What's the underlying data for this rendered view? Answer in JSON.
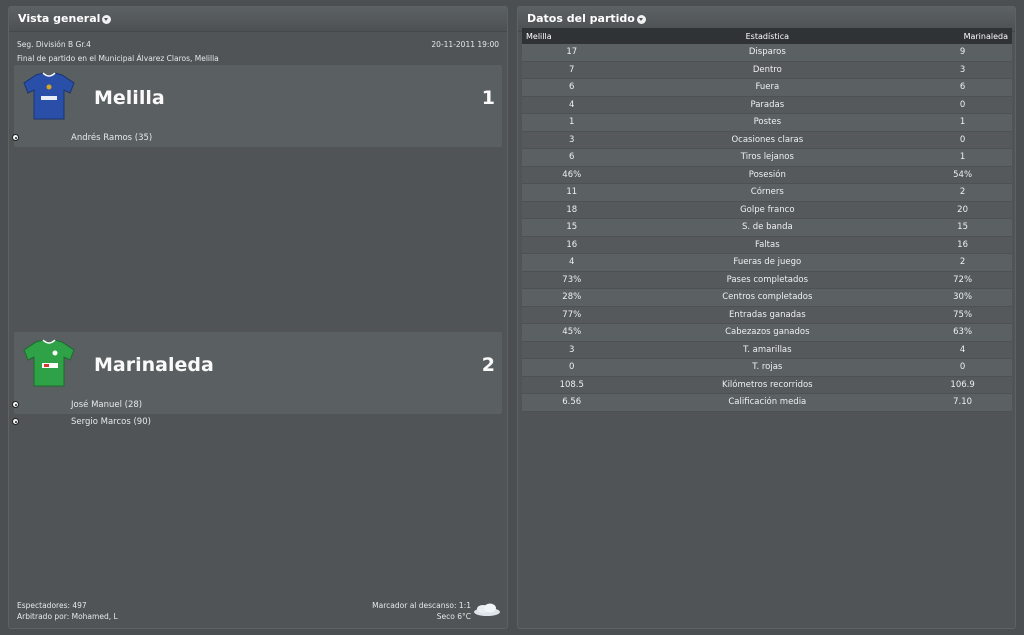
{
  "overview": {
    "title": "Vista general",
    "competition": "Seg. División B Gr.4",
    "datetime": "20-11-2011 19:00",
    "venue": "Final de partido en el Municipal Álvarez Claros, Melilla",
    "home": {
      "name": "Melilla",
      "score": "1",
      "scorers": [
        "Andrés Ramos (35)"
      ]
    },
    "away": {
      "name": "Marinaleda",
      "score": "2",
      "scorers": [
        "José Manuel (28)",
        "Sergio Marcos (90)"
      ]
    },
    "attendance": "Espectadores: 497",
    "referee": "Arbitrado por: Mohamed, L",
    "halftime": "Marcador al descanso: 1:1",
    "weather": "Seco 6°C"
  },
  "stats": {
    "title": "Datos del partido",
    "headers": [
      "Melilla",
      "Estadística",
      "Marinaleda"
    ],
    "rows": [
      [
        "17",
        "Disparos",
        "9"
      ],
      [
        "7",
        "Dentro",
        "3"
      ],
      [
        "6",
        "Fuera",
        "6"
      ],
      [
        "4",
        "Paradas",
        "0"
      ],
      [
        "1",
        "Postes",
        "1"
      ],
      [
        "3",
        "Ocasiones claras",
        "0"
      ],
      [
        "6",
        "Tiros lejanos",
        "1"
      ],
      [
        "46%",
        "Posesión",
        "54%"
      ],
      [
        "11",
        "Córners",
        "2"
      ],
      [
        "18",
        "Golpe franco",
        "20"
      ],
      [
        "15",
        "S. de banda",
        "15"
      ],
      [
        "16",
        "Faltas",
        "16"
      ],
      [
        "4",
        "Fueras de juego",
        "2"
      ],
      [
        "73%",
        "Pases completados",
        "72%"
      ],
      [
        "28%",
        "Centros completados",
        "30%"
      ],
      [
        "77%",
        "Entradas ganadas",
        "75%"
      ],
      [
        "45%",
        "Cabezazos ganados",
        "63%"
      ],
      [
        "3",
        "T. amarillas",
        "4"
      ],
      [
        "0",
        "T. rojas",
        "0"
      ],
      [
        "108.5",
        "Kilómetros recorridos",
        "106.9"
      ],
      [
        "6.56",
        "Calificación media",
        "7.10"
      ]
    ]
  },
  "icons": {
    "dropdown": "chevron-down-circle-icon",
    "ball": "football-icon",
    "home_kit": "blue-shirt-icon",
    "away_kit": "green-shirt-icon",
    "weather": "cloud-icon"
  },
  "colors": {
    "home_kit": "#2a4fa8",
    "away_kit": "#2fa147"
  }
}
